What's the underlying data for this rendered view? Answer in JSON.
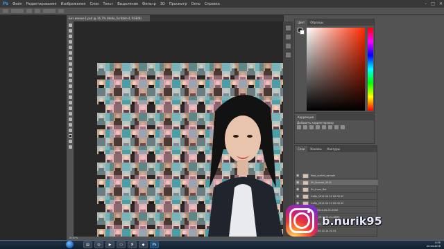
{
  "menubar": {
    "logo": "Ps",
    "items": [
      "Файл",
      "Редактирование",
      "Изображение",
      "Слои",
      "Текст",
      "Выделение",
      "Фильтр",
      "3D",
      "Просмотр",
      "Окно",
      "Справка"
    ]
  },
  "document": {
    "tab_title": "Без имени-1.psd @ 16,7% (Hello_Scribble 4, RGB/8)"
  },
  "panels": {
    "color_tabs": [
      "Цвет",
      "Образцы"
    ],
    "adjustments_tabs": [
      "Коррекция"
    ],
    "adjustments_title": "Добавить корректировку",
    "layers_tabs": [
      "Слои",
      "Каналы",
      "Контуры"
    ]
  },
  "layers": [
    {
      "name": "Now_scaled_sample"
    },
    {
      "name": "Sh_Scanne_2014"
    },
    {
      "name": "Sh_Invar_Rot"
    },
    {
      "name": "Собр_2014 04 22 00 00 00"
    },
    {
      "name": "Собр_2014 04 22 00 00 00"
    },
    {
      "name": "Сбр_2014-04-21-0000"
    },
    {
      "name": "Слой_2014-04-21-0000"
    },
    {
      "name": "2014 04 22 00 00 00"
    },
    {
      "name": "2014 04 22 14 22 01"
    },
    {
      "name": "2014 04 22 14 22 01"
    }
  ],
  "status": {
    "zoom": "16,67%"
  },
  "taskbar": {
    "time": "0:55",
    "date": "22.04.2016"
  },
  "overlay": {
    "handle": "b.nurik95"
  },
  "colors": {
    "accent_ps": "#2fa3f7",
    "ui_dark": "#535353",
    "canvas_bg": "#282828"
  }
}
